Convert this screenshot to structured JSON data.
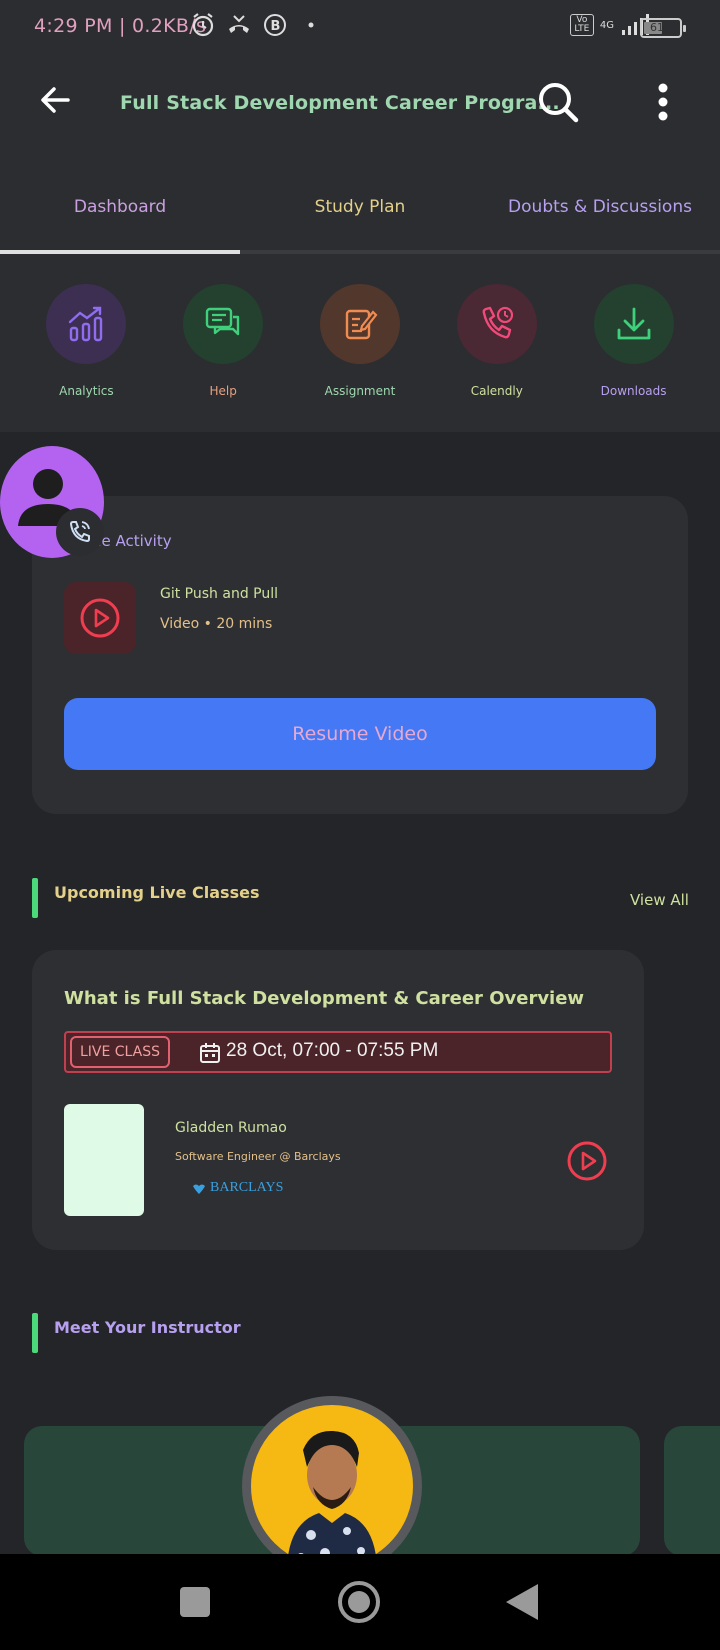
{
  "status_bar": {
    "time_speed": "4:29 PM | 0.2KB/s",
    "network": "4G",
    "volte": "Vo LTE",
    "battery": "61"
  },
  "header": {
    "title": "Full Stack Development Career Progra..."
  },
  "tabs": [
    {
      "label": "Dashboard",
      "active": true
    },
    {
      "label": "Study Plan",
      "active": false
    },
    {
      "label": "Doubts & Discussions",
      "active": false
    }
  ],
  "quick_actions": [
    {
      "label": "Analytics",
      "icon": "analytics-icon",
      "bg": "#3d2f52",
      "color": "#8f6cf0"
    },
    {
      "label": "Help",
      "icon": "chat-icon",
      "bg": "#24402f",
      "color": "#3ed07a"
    },
    {
      "label": "Assignment",
      "icon": "assignment-icon",
      "bg": "#52372c",
      "color": "#f08c52"
    },
    {
      "label": "Calendly",
      "icon": "phone-clock-icon",
      "bg": "#4a2834",
      "color": "#f04a7a"
    },
    {
      "label": "Downloads",
      "icon": "download-icon",
      "bg": "#24402f",
      "color": "#3ed07a"
    }
  ],
  "activity": {
    "heading": "ue Activity",
    "title": "Git Push and Pull",
    "meta": "Video • 20 mins",
    "resume_label": "Resume Video"
  },
  "upcoming": {
    "heading": "Upcoming Live Classes",
    "view_all": "View All",
    "class_title": "What is Full Stack Development & Career Overview",
    "badge": "LIVE CLASS",
    "datetime": "28 Oct, 07:00 - 07:55 PM",
    "teacher_name": "Gladden Rumao",
    "teacher_role": "Software Engineer @ Barclays",
    "company": "BARCLAYS"
  },
  "instructor": {
    "heading": "Meet Your Instructor"
  }
}
